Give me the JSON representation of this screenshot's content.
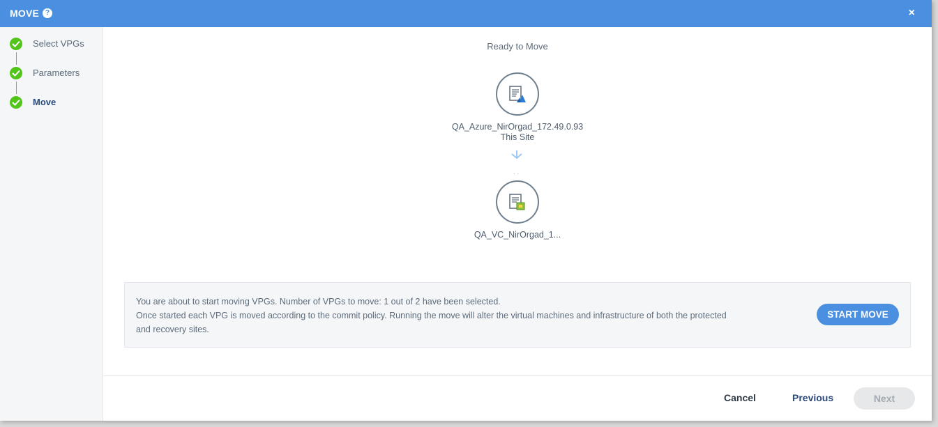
{
  "dialog": {
    "title": "MOVE",
    "help_icon": "question-circle-icon",
    "close_label": "×"
  },
  "steps": [
    {
      "label": "Select VPGs",
      "status": "complete"
    },
    {
      "label": "Parameters",
      "status": "complete"
    },
    {
      "label": "Move",
      "status": "active"
    }
  ],
  "main": {
    "status": "Ready to Move",
    "source": {
      "name": "QA_Azure_NirOrgad_172.49.0.93",
      "subtitle": "This Site",
      "icon": "azure-site-icon"
    },
    "target": {
      "name": "QA_VC_NirOrgad_1...",
      "icon": "vcenter-site-icon"
    }
  },
  "info": {
    "line1": "You are about to start moving VPGs. Number of VPGs to move: 1 out of 2 have been selected.",
    "line2": "Once started each VPG is moved according to the commit policy. Running the move will alter the virtual machines and infrastructure of both the protected and recovery sites.",
    "start_label": "START MOVE"
  },
  "footer": {
    "cancel_label": "Cancel",
    "previous_label": "Previous",
    "next_label": "Next"
  },
  "colors": {
    "header": "#4a8fe0",
    "check": "#52c41a",
    "primary": "#4a8fe0"
  }
}
